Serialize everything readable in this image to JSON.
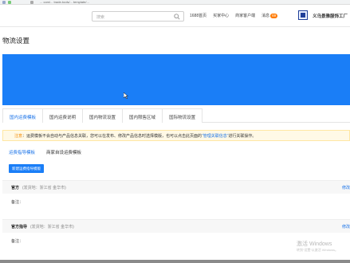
{
  "browser": {
    "url_fragment": "... com/... trade-tools/... template/..."
  },
  "topnav": {
    "search_placeholder": "搜索",
    "links": [
      "1688首页",
      "买家中心",
      "商家客户端"
    ],
    "messages_label": "消息",
    "messages_count": "69",
    "shop_name": "义乌景雅服饰工厂"
  },
  "page": {
    "title": "物流设置"
  },
  "tabs": [
    {
      "label": "国内运费模板",
      "active": true
    },
    {
      "label": "国内运费说明",
      "active": false
    },
    {
      "label": "国内物流设置",
      "active": false
    },
    {
      "label": "国内限售区域",
      "active": false
    },
    {
      "label": "国际物流设置",
      "active": false
    }
  ],
  "notice": {
    "tag": "注意",
    "text_before": "：运费模板不会自动与产品信息关联，您可以在发布、修改产品信息时选择模版，也可以点击此页面的",
    "link": "“管理关联信息”",
    "text_after": "进行关联操作。"
  },
  "subtabs": [
    {
      "label": "运费指导模板",
      "active": true
    },
    {
      "label": "商家自设运费模板",
      "active": false
    }
  ],
  "new_button": "新建运费指导模版",
  "cards": [
    {
      "name": "官方",
      "from": "(发货地：浙江省 金华市)",
      "edit": "修改",
      "note": "备注："
    },
    {
      "name": "官方指导",
      "from": "(发货地：浙江省 金华市)",
      "edit": "修改",
      "note": "备注："
    }
  ],
  "watermark": {
    "line1": "激活 Windows",
    "line2": "转到“设置”以激活 Windows。"
  },
  "colors": {
    "accent": "#1a7ef7",
    "link": "#1a73e8",
    "badge": "#ff7a00",
    "notice_bg": "#fff9e6"
  }
}
